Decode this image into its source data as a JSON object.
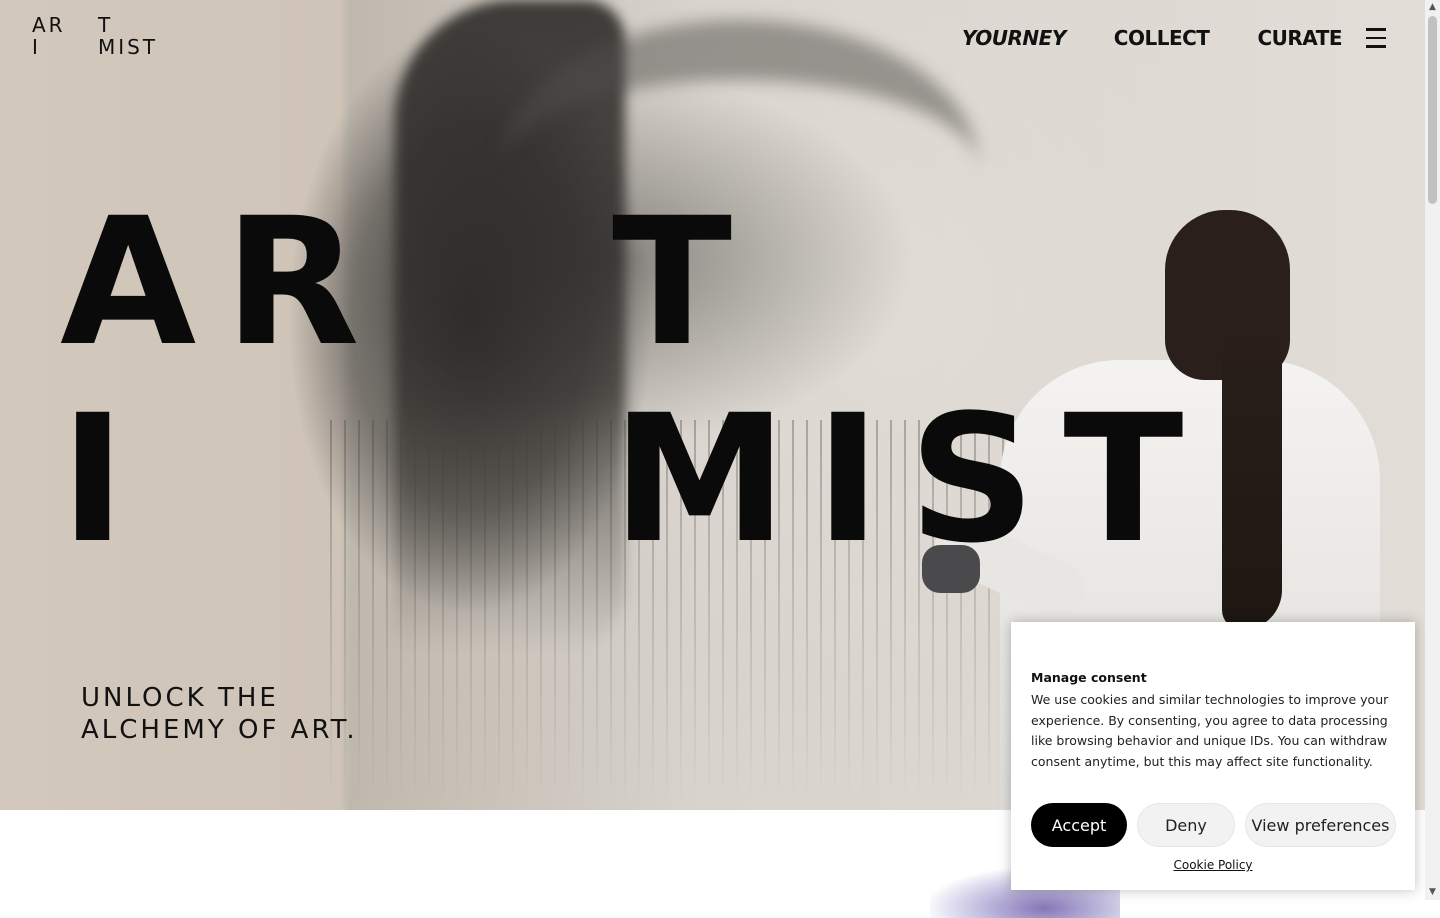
{
  "brand": {
    "logo_line1_left": "AR",
    "logo_line1_right": "T",
    "logo_line2_left": "I",
    "logo_line2_right": "MIST"
  },
  "nav": {
    "items": [
      {
        "label": "YOURNEY"
      },
      {
        "label": "COLLECT"
      },
      {
        "label": "CURATE"
      }
    ],
    "menu_icon": "hamburger-icon"
  },
  "hero": {
    "big_line1_left": "AR",
    "big_line1_right": "T",
    "big_line2_left": "I",
    "big_line2_right": "MIST",
    "tagline_line1": "UNLOCK THE",
    "tagline_line2": "ALCHEMY OF ART."
  },
  "consent": {
    "title": "Manage consent",
    "text": "We use cookies and similar technologies to improve your experience. By consenting, you agree to data processing like browsing behavior and unique IDs. You can withdraw consent anytime, but this may affect site functionality.",
    "accept_label": "Accept",
    "deny_label": "Deny",
    "preferences_label": "View preferences",
    "policy_label": "Cookie Policy"
  },
  "colors": {
    "accent": "#000000",
    "text": "#111111",
    "button_secondary": "#f2f2f2"
  }
}
